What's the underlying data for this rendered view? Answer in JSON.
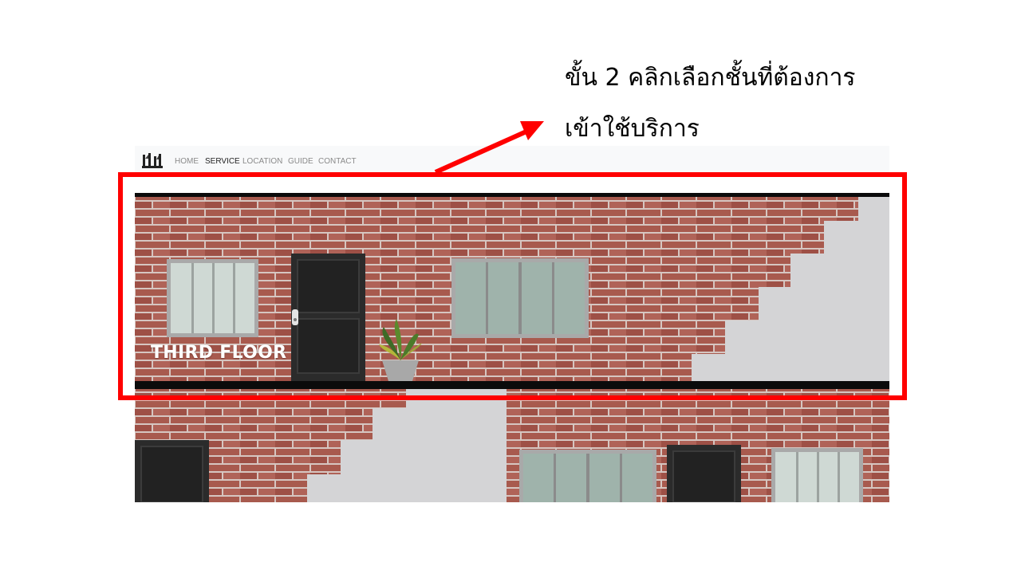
{
  "instruction": {
    "line1": "ขั้น 2 คลิกเลือกชั้นที่ต้องการ",
    "line2": "เข้าใช้บริการ"
  },
  "navbar": {
    "items": [
      {
        "label": "HOME",
        "active": false
      },
      {
        "label": "SERVICE",
        "active": true
      },
      {
        "label": "LOCATION",
        "active": false
      },
      {
        "label": "GUIDE",
        "active": false
      },
      {
        "label": "CONTACT",
        "active": false
      }
    ]
  },
  "floors": {
    "third": {
      "label": "THIRD FLOOR"
    }
  },
  "colors": {
    "highlight": "#ff0000",
    "brick": "#a6554a",
    "mortar": "#d9c9c4",
    "door": "#2b2b2b",
    "wall": "#d4d4d6"
  },
  "icons": [
    "site-logo-icon",
    "plant-pot-icon",
    "arrow-icon"
  ]
}
